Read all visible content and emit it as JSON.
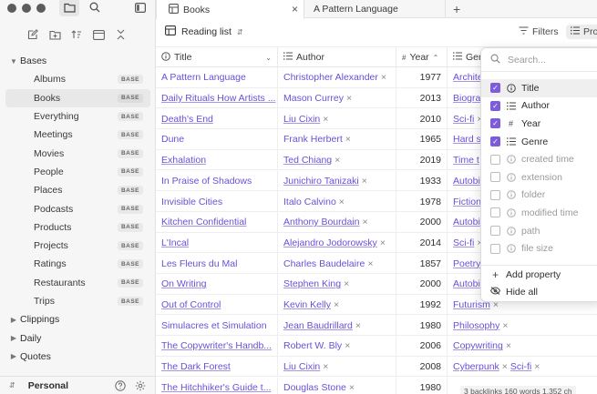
{
  "sidebar": {
    "section_title": "Bases",
    "items": [
      {
        "label": "Albums",
        "badge": "BASE"
      },
      {
        "label": "Books",
        "badge": "BASE",
        "active": true
      },
      {
        "label": "Everything",
        "badge": "BASE"
      },
      {
        "label": "Meetings",
        "badge": "BASE"
      },
      {
        "label": "Movies",
        "badge": "BASE"
      },
      {
        "label": "People",
        "badge": "BASE"
      },
      {
        "label": "Places",
        "badge": "BASE"
      },
      {
        "label": "Podcasts",
        "badge": "BASE"
      },
      {
        "label": "Products",
        "badge": "BASE"
      },
      {
        "label": "Projects",
        "badge": "BASE"
      },
      {
        "label": "Ratings",
        "badge": "BASE"
      },
      {
        "label": "Restaurants",
        "badge": "BASE"
      },
      {
        "label": "Trips",
        "badge": "BASE"
      }
    ],
    "folders": [
      "Clippings",
      "Daily",
      "Quotes"
    ],
    "vault_name": "Personal"
  },
  "tabs": [
    {
      "label": "Books",
      "active": true
    },
    {
      "label": "A Pattern Language",
      "active": false
    }
  ],
  "toolbar": {
    "view_label": "Reading list",
    "filters_label": "Filters",
    "properties_label": "Pro"
  },
  "columns": {
    "title": "Title",
    "author": "Author",
    "year": "Year",
    "genre": "Gen"
  },
  "rows": [
    {
      "title": "A Pattern Language",
      "title_link": false,
      "author": "Christopher Alexander",
      "author_link": false,
      "year": "1977",
      "genre": [
        "Archite"
      ]
    },
    {
      "title": "Daily Rituals How Artists ...",
      "title_link": true,
      "author": "Mason Currey",
      "author_link": false,
      "year": "2013",
      "genre": [
        "Biogra"
      ]
    },
    {
      "title": "Death's End",
      "title_link": true,
      "author": "Liu Cixin",
      "author_link": true,
      "year": "2010",
      "genre": [
        "Sci-fi"
      ]
    },
    {
      "title": "Dune",
      "title_link": false,
      "author": "Frank Herbert",
      "author_link": false,
      "year": "1965",
      "genre": [
        "Hard s"
      ]
    },
    {
      "title": "Exhalation",
      "title_link": true,
      "author": "Ted Chiang",
      "author_link": true,
      "year": "2019",
      "genre": [
        "Time t"
      ]
    },
    {
      "title": "In Praise of Shadows",
      "title_link": false,
      "author": "Junichiro Tanizaki",
      "author_link": true,
      "year": "1933",
      "genre": [
        "Autobi"
      ]
    },
    {
      "title": "Invisible Cities",
      "title_link": false,
      "author": "Italo Calvino",
      "author_link": false,
      "year": "1978",
      "genre": [
        "Fiction"
      ]
    },
    {
      "title": "Kitchen Confidential",
      "title_link": true,
      "author": "Anthony Bourdain",
      "author_link": true,
      "year": "2000",
      "genre": [
        "Autobi"
      ]
    },
    {
      "title": "L'Incal",
      "title_link": true,
      "author": "Alejandro Jodorowsky",
      "author_link": true,
      "year": "2014",
      "genre": [
        "Sci-fi"
      ]
    },
    {
      "title": "Les Fleurs du Mal",
      "title_link": false,
      "author": "Charles Baudelaire",
      "author_link": false,
      "year": "1857",
      "genre": [
        "Poetry"
      ]
    },
    {
      "title": "On Writing",
      "title_link": true,
      "author": "Stephen King",
      "author_link": true,
      "year": "2000",
      "genre": [
        "Autobi"
      ]
    },
    {
      "title": "Out of Control",
      "title_link": true,
      "author": "Kevin Kelly",
      "author_link": true,
      "year": "1992",
      "genre": [
        "Futurism"
      ]
    },
    {
      "title": "Simulacres et Simulation",
      "title_link": false,
      "author": "Jean Baudrillard",
      "author_link": true,
      "year": "1980",
      "genre": [
        "Philosophy"
      ]
    },
    {
      "title": "The Copywriter's Handb...",
      "title_link": true,
      "author": "Robert W. Bly",
      "author_link": false,
      "year": "2006",
      "genre": [
        "Copywriting"
      ]
    },
    {
      "title": "The Dark Forest",
      "title_link": true,
      "author": "Liu Cixin",
      "author_link": true,
      "year": "2008",
      "genre": [
        "Cyberpunk",
        "Sci-fi"
      ]
    },
    {
      "title": "The Hitchhiker's Guide t...",
      "title_link": true,
      "author": "Douglas Stone",
      "author_link": false,
      "year": "1980",
      "genre": []
    }
  ],
  "properties_popover": {
    "search_placeholder": "Search...",
    "items": [
      {
        "label": "Title",
        "checked": true,
        "icon": "info-icon"
      },
      {
        "label": "Author",
        "checked": true,
        "icon": "list-icon"
      },
      {
        "label": "Year",
        "checked": true,
        "icon": "number-icon"
      },
      {
        "label": "Genre",
        "checked": true,
        "icon": "list-icon"
      },
      {
        "label": "created time",
        "checked": false,
        "icon": "info-icon"
      },
      {
        "label": "extension",
        "checked": false,
        "icon": "info-icon"
      },
      {
        "label": "folder",
        "checked": false,
        "icon": "info-icon"
      },
      {
        "label": "modified time",
        "checked": false,
        "icon": "info-icon"
      },
      {
        "label": "path",
        "checked": false,
        "icon": "info-icon"
      },
      {
        "label": "file size",
        "checked": false,
        "icon": "info-icon"
      }
    ],
    "add_property_label": "Add property",
    "hide_all_label": "Hide all"
  },
  "status_bar": "3 backlinks   160 words   1,352 ch",
  "colors": {
    "accent": "#7c5cdb",
    "link": "#6b4fd8"
  }
}
